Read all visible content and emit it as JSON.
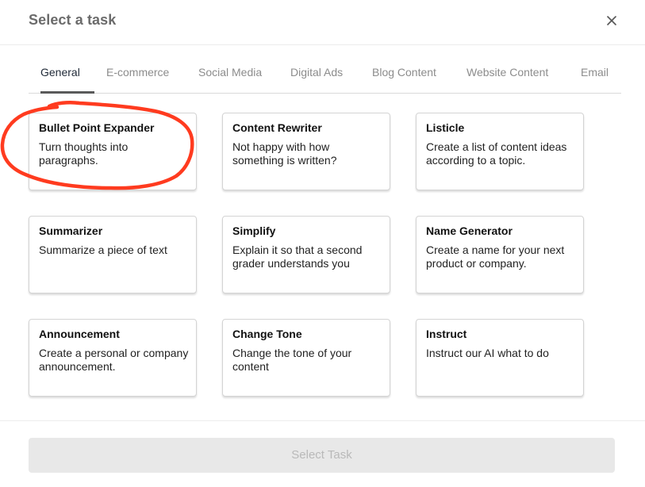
{
  "header": {
    "title": "Select a task",
    "close_icon": "close-icon"
  },
  "tabs": [
    {
      "label": "General",
      "active": true
    },
    {
      "label": "E-commerce",
      "active": false
    },
    {
      "label": "Social Media",
      "active": false
    },
    {
      "label": "Digital Ads",
      "active": false
    },
    {
      "label": "Blog Content",
      "active": false
    },
    {
      "label": "Website Content",
      "active": false
    },
    {
      "label": "Email",
      "active": false
    }
  ],
  "cards": [
    {
      "title": "Bullet Point Expander",
      "description": "Turn thoughts into paragraphs."
    },
    {
      "title": "Content Rewriter",
      "description": "Not happy with how something is written?"
    },
    {
      "title": "Listicle",
      "description": "Create a list of content ideas according to a topic."
    },
    {
      "title": "Summarizer",
      "description": "Summarize a piece of text"
    },
    {
      "title": "Simplify",
      "description": "Explain it so that a second grader understands you"
    },
    {
      "title": "Name Generator",
      "description": "Create a name for your next product or company."
    },
    {
      "title": "Announcement",
      "description": "Create a personal or company announcement."
    },
    {
      "title": "Change Tone",
      "description": "Change the tone of your content"
    },
    {
      "title": "Instruct",
      "description": "Instruct our AI what to do"
    }
  ],
  "footer": {
    "select_label": "Select Task",
    "disabled": true
  },
  "colors": {
    "annotation": "#ff3b1f",
    "active_tab_underline": "#5a5a5a",
    "disabled_button_bg": "#e8e8e8"
  }
}
